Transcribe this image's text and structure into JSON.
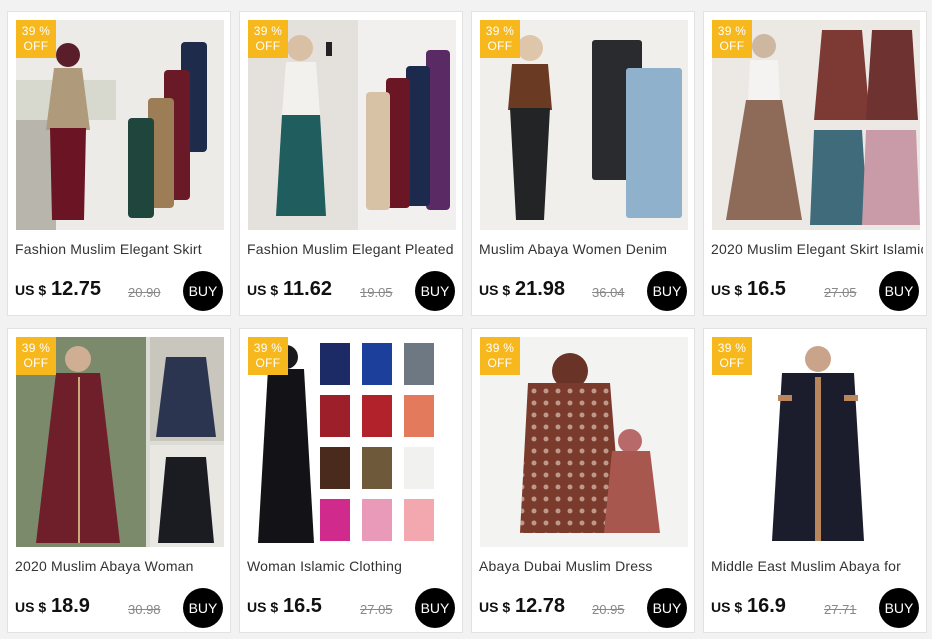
{
  "products": [
    {
      "title": "Fashion Muslim Elegant Skirt",
      "currency": "US $",
      "price": "12.75",
      "old_price": "20.90",
      "badge_pct": "39 %",
      "badge_off": "OFF",
      "buy_label": "BUY",
      "image": "woman-hijab-long-skirts-maroon-green-tan"
    },
    {
      "title": "Fashion Muslim Elegant Pleated",
      "currency": "US $",
      "price": "11.62",
      "old_price": "19.05",
      "badge_pct": "39 %",
      "badge_off": "OFF",
      "buy_label": "BUY",
      "image": "woman-teal-pleated-skirt-selfie"
    },
    {
      "title": "Muslim Abaya Women Denim",
      "currency": "US $",
      "price": "21.98",
      "old_price": "36.04",
      "badge_pct": "39 %",
      "badge_off": "OFF",
      "buy_label": "BUY",
      "image": "woman-denim-skirts-black-blue"
    },
    {
      "title": "2020 Muslim Elegant Skirt Islamic",
      "currency": "US $",
      "price": "16.5",
      "old_price": "27.05",
      "badge_pct": "39 %",
      "badge_off": "OFF",
      "buy_label": "BUY",
      "image": "woman-button-maxi-skirts-grid"
    },
    {
      "title": "2020 Muslim Abaya Woman",
      "currency": "US $",
      "price": "18.9",
      "old_price": "30.98",
      "badge_pct": "39 %",
      "badge_off": "OFF",
      "buy_label": "BUY",
      "image": "women-maroon-navy-abaya-dresses"
    },
    {
      "title": "Woman Islamic Clothing",
      "currency": "US $",
      "price": "16.5",
      "old_price": "27.05",
      "badge_pct": "39 %",
      "badge_off": "OFF",
      "buy_label": "BUY",
      "image": "black-abaya-with-color-swatches"
    },
    {
      "title": "Abaya Dubai Muslim Dress",
      "currency": "US $",
      "price": "12.78",
      "old_price": "20.95",
      "badge_pct": "39 %",
      "badge_off": "OFF",
      "buy_label": "BUY",
      "image": "mother-daughter-floral-prayer-dress"
    },
    {
      "title": "Middle East Muslim Abaya for",
      "currency": "US $",
      "price": "16.9",
      "old_price": "27.71",
      "badge_pct": "39 %",
      "badge_off": "OFF",
      "buy_label": "BUY",
      "image": "woman-black-embroidered-abaya"
    }
  ],
  "colors": {
    "badge": "#f6b81d",
    "buy_button": "#000000",
    "page_background": "#f2f2f2",
    "card_background": "#ffffff"
  }
}
